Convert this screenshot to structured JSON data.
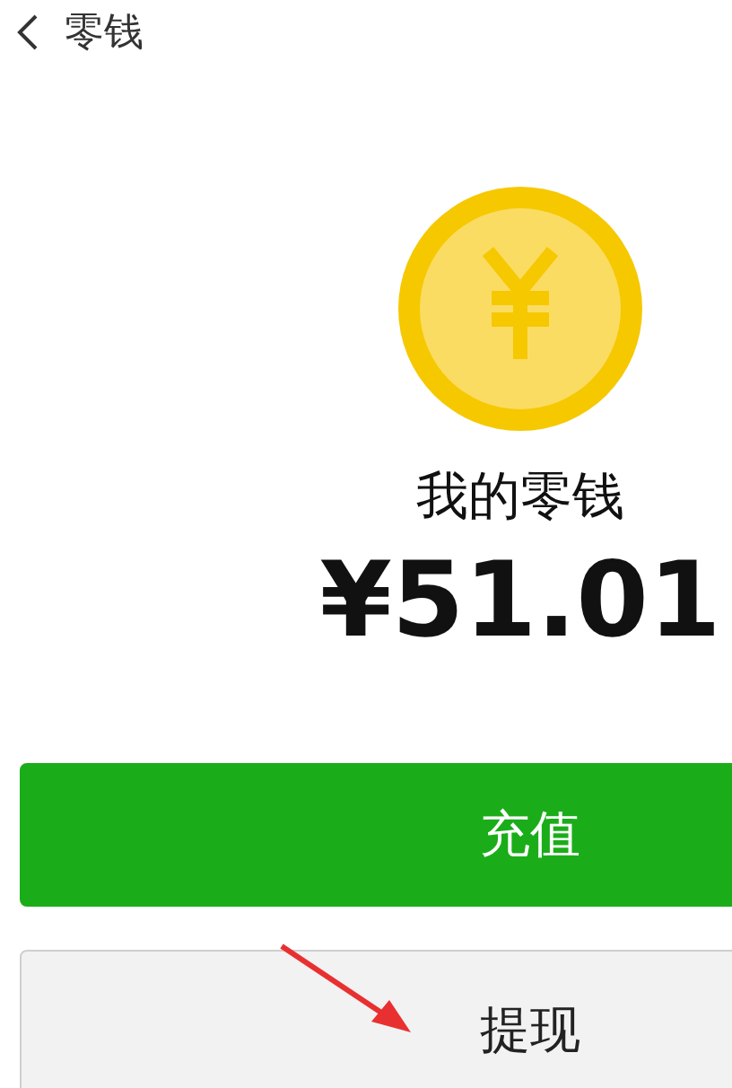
{
  "header": {
    "title": "零钱"
  },
  "balance": {
    "label": "我的零钱",
    "amount": "¥51.01"
  },
  "buttons": [
    {
      "label": "充值",
      "kind": "primary"
    },
    {
      "label": "提现",
      "kind": "secondary"
    }
  ]
}
